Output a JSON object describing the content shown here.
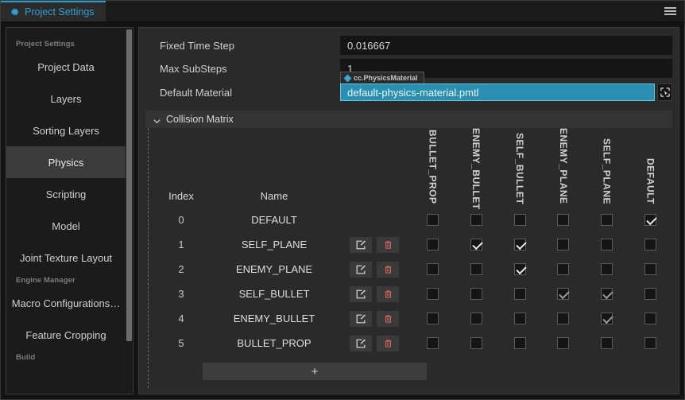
{
  "window": {
    "tab": {
      "label": "Project Settings",
      "icon": "gear-icon"
    },
    "menu_icon": "hamburger-menu-icon"
  },
  "sidebar": {
    "groups": [
      {
        "label": "Project Settings",
        "items": [
          {
            "label": "Project Data",
            "active": false
          },
          {
            "label": "Layers",
            "active": false
          },
          {
            "label": "Sorting Layers",
            "active": false
          },
          {
            "label": "Physics",
            "active": true
          },
          {
            "label": "Scripting",
            "active": false
          },
          {
            "label": "Model",
            "active": false
          },
          {
            "label": "Joint Texture Layout",
            "active": false
          }
        ]
      },
      {
        "label": "Engine Manager",
        "items": [
          {
            "label": "Macro Configurations…",
            "active": false
          },
          {
            "label": "Feature Cropping",
            "active": false
          }
        ]
      },
      {
        "label": "Build",
        "items": []
      }
    ]
  },
  "main": {
    "fields": [
      {
        "label": "Fixed Time Step",
        "value": "0.016667"
      },
      {
        "label": "Max SubSteps",
        "value": "1"
      }
    ],
    "material": {
      "label": "Default Material",
      "value": "default-physics-material.pmtl",
      "tooltip": "cc.PhysicsMaterial",
      "locate_icon": "locate-asset-icon"
    },
    "collision_matrix": {
      "title": "Collision Matrix",
      "expanded": true,
      "chevron_icon": "chevron-down-icon",
      "columns": [
        {
          "label": "Index"
        },
        {
          "label": "Name"
        }
      ],
      "matrix_columns": [
        "BULLET_PROP",
        "ENEMY_BULLET",
        "SELF_BULLET",
        "ENEMY_PLANE",
        "SELF_PLANE",
        "DEFAULT"
      ],
      "rows": [
        {
          "index": "0",
          "name": "DEFAULT",
          "actions": false,
          "checks": [
            false,
            false,
            false,
            false,
            false,
            true
          ],
          "dim": false
        },
        {
          "index": "1",
          "name": "SELF_PLANE",
          "actions": true,
          "checks": [
            false,
            true,
            true,
            false,
            false,
            false
          ],
          "dim": false
        },
        {
          "index": "2",
          "name": "ENEMY_PLANE",
          "actions": true,
          "checks": [
            false,
            false,
            true,
            false,
            false,
            false
          ],
          "dim": false
        },
        {
          "index": "3",
          "name": "SELF_BULLET",
          "actions": true,
          "checks": [
            false,
            false,
            false,
            true,
            true,
            false
          ],
          "dim": true
        },
        {
          "index": "4",
          "name": "ENEMY_BULLET",
          "actions": true,
          "checks": [
            false,
            false,
            false,
            false,
            true,
            false
          ],
          "dim": true
        },
        {
          "index": "5",
          "name": "BULLET_PROP",
          "actions": true,
          "checks": [
            false,
            false,
            false,
            false,
            false,
            false
          ],
          "dim": false
        }
      ],
      "row_actions": {
        "edit_icon": "edit-pencil-icon",
        "delete_icon": "trash-delete-icon"
      },
      "add_button": {
        "label": "+",
        "icon": "plus-icon"
      }
    }
  },
  "colors": {
    "accent": "#2f9fd0",
    "selection": "#2a8fb0",
    "panel": "#2a2a2a",
    "sidebar": "#1b1b1b",
    "input": "#151515",
    "delete": "#d9675d"
  }
}
